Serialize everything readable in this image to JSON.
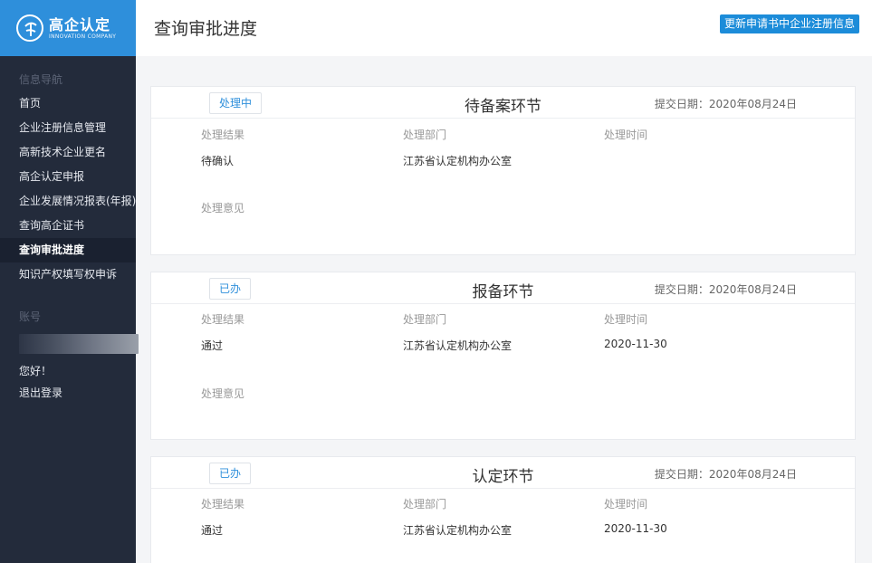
{
  "brand": {
    "title": "高企认定",
    "subtitle": "INNOVATION COMPANY"
  },
  "header": {
    "title": "查询审批进度",
    "update_button": "更新申请书中企业注册信息"
  },
  "sidebar": {
    "nav_title": "信息导航",
    "items": [
      {
        "label": "首页"
      },
      {
        "label": "企业注册信息管理"
      },
      {
        "label": "高新技术企业更名"
      },
      {
        "label": "高企认定申报"
      },
      {
        "label": "企业发展情况报表(年报)"
      },
      {
        "label": "查询高企证书"
      },
      {
        "label": "查询审批进度",
        "active": true
      },
      {
        "label": "知识产权填写权申诉"
      }
    ],
    "account_title": "账号",
    "greeting": "您好！",
    "logout": "退出登录"
  },
  "columns": {
    "result": "处理结果",
    "department": "处理部门",
    "time": "处理时间",
    "opinion": "处理意见"
  },
  "stages": [
    {
      "status": "处理中",
      "name": "待备案环节",
      "submit_date": "提交日期：2020年08月24日",
      "result": "待确认",
      "department": "江苏省认定机构办公室",
      "time": ""
    },
    {
      "status": "已办",
      "name": "报备环节",
      "submit_date": "提交日期：2020年08月24日",
      "result": "通过",
      "department": "江苏省认定机构办公室",
      "time": "2020-11-30"
    },
    {
      "status": "已办",
      "name": "认定环节",
      "submit_date": "提交日期：2020年08月24日",
      "result": "通过",
      "department": "江苏省认定机构办公室",
      "time": "2020-11-30"
    }
  ],
  "colors": {
    "brand_blue": "#2e8fdb",
    "sidebar_bg": "#232b3b",
    "button_blue": "#1c8cd9"
  }
}
